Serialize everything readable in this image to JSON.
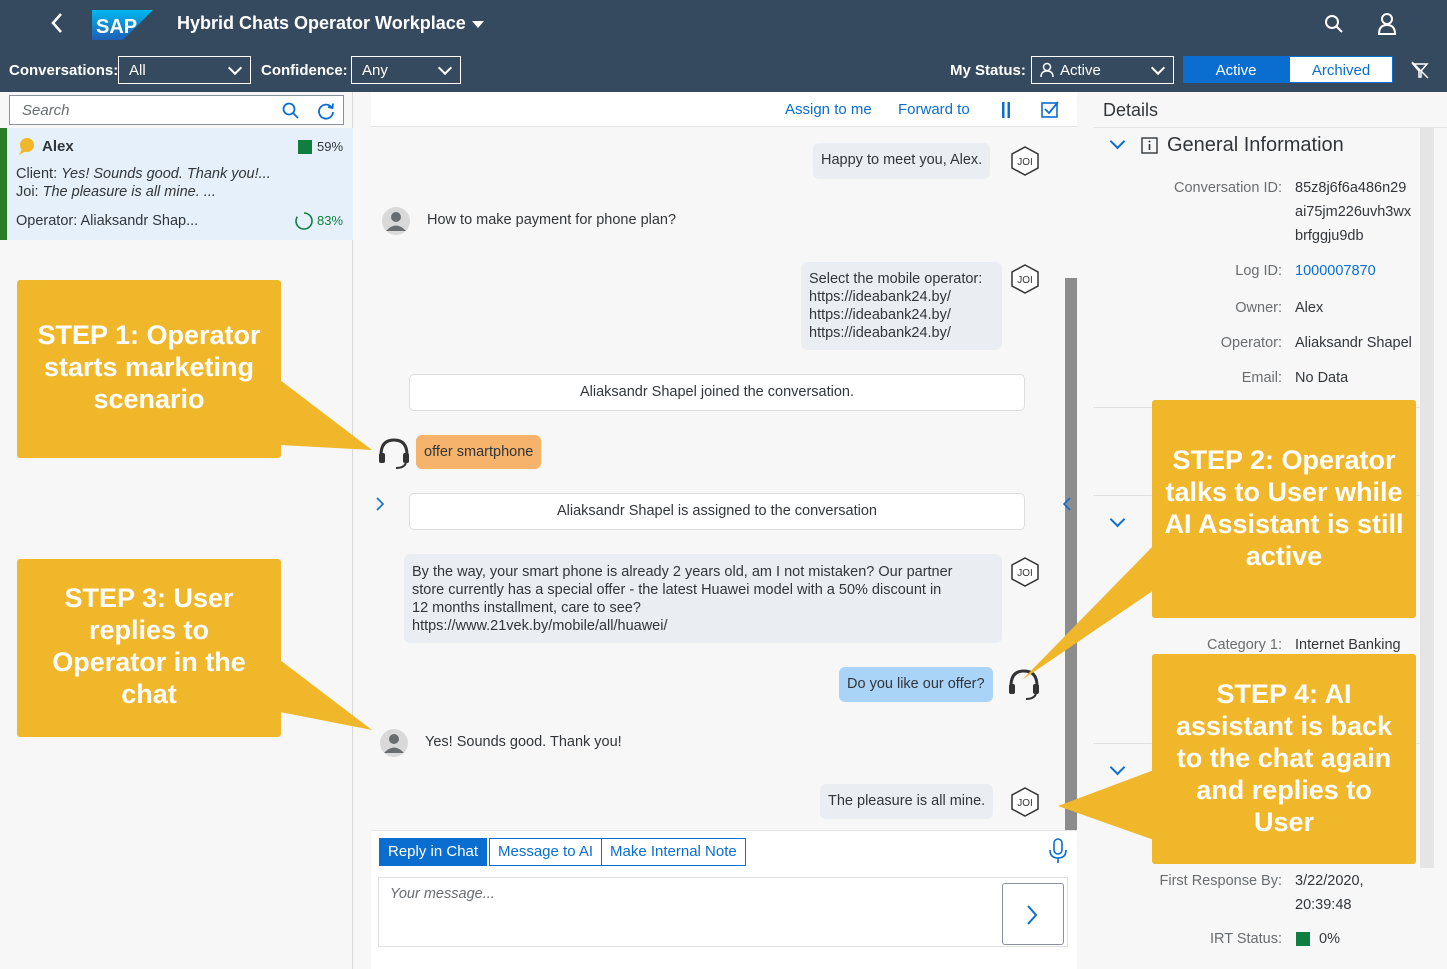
{
  "shell": {
    "logo": "SAP",
    "title": "Hybrid Chats Operator Workplace"
  },
  "toolbar": {
    "conversations_label": "Conversations:",
    "conversations_value": "All",
    "confidence_label": "Confidence:",
    "confidence_value": "Any",
    "status_label": "My Status:",
    "status_value": "Active",
    "seg_active": "Active",
    "seg_archived": "Archived"
  },
  "left": {
    "search_placeholder": "Search",
    "conversation": {
      "name": "Alex",
      "confidence": "59%",
      "client_label": "Client:",
      "client_text": "Yes! Sounds good. Thank you!...",
      "joi_label": "Joi:",
      "joi_text": "The pleasure is all mine. ...",
      "operator": "Operator: Aliaksandr Shap...",
      "progress": "83%"
    }
  },
  "callouts": {
    "step1": "STEP 1: Operator starts marketing scenario",
    "step2": "STEP 2: Operator talks to User while AI Assistant is still active",
    "step3": "STEP 3: User replies to Operator in the chat",
    "step4": "STEP 4: AI assistant is back to the chat again and replies to User"
  },
  "chat": {
    "assign": "Assign to me",
    "forward": "Forward to",
    "bot_avatar": "JOI",
    "messages": {
      "m1": "Happy to meet you, Alex.",
      "m2": "How to make payment for phone plan?",
      "m3_l1": "Select the mobile operator:",
      "m3_l2": "https://ideabank24.by/",
      "m3_l3": "https://ideabank24.by/",
      "m3_l4": "https://ideabank24.by/",
      "sys1": "Aliaksandr Shapel joined the conversation.",
      "op1": "offer smartphone",
      "sys2": "Aliaksandr Shapel is assigned to the conversation",
      "m4_l1": "By the way, your smart phone is already 2 years old, am I not mistaken? Our partner",
      "m4_l2": "store currently has a special offer - the latest Huawei model with a 50% discount in",
      "m4_l3": "12 months installment, care to see?",
      "m4_l4": "https://www.21vek.by/mobile/all/huawei/",
      "op2": "Do you like our offer?",
      "m5": "Yes! Sounds good. Thank you!",
      "m6": "The pleasure is all mine."
    },
    "tabs": [
      "Reply in Chat",
      "Message to AI",
      "Make Internal Note"
    ],
    "input_placeholder": "Your message..."
  },
  "details": {
    "header": "Details",
    "general_title": "General Information",
    "conversation_id_label": "Conversation ID:",
    "conversation_id_l1": "85z8j6f6a486n29",
    "conversation_id_l2": "ai75jm226uvh3wx",
    "conversation_id_l3": "brfggju9db",
    "log_id_label": "Log ID:",
    "log_id": "1000007870",
    "owner_label": "Owner:",
    "owner": "Alex",
    "operator_label": "Operator:",
    "operator": "Aliaksandr Shapel",
    "email_label": "Email:",
    "email": "No Data",
    "category_label": "Category 1:",
    "category": "Internet Banking",
    "first_response_label": "First Response By:",
    "first_response_l1": "3/22/2020,",
    "first_response_l2": "20:39:48",
    "irt_label": "IRT Status:",
    "irt": "0%"
  },
  "colors": {
    "shell": "#354a5f",
    "accent": "#0a6ed1",
    "callout": "#f0b72a",
    "operator_bubble": "#f5b36c",
    "operator_blue": "#a9d4f7",
    "positive": "#107e3e"
  }
}
